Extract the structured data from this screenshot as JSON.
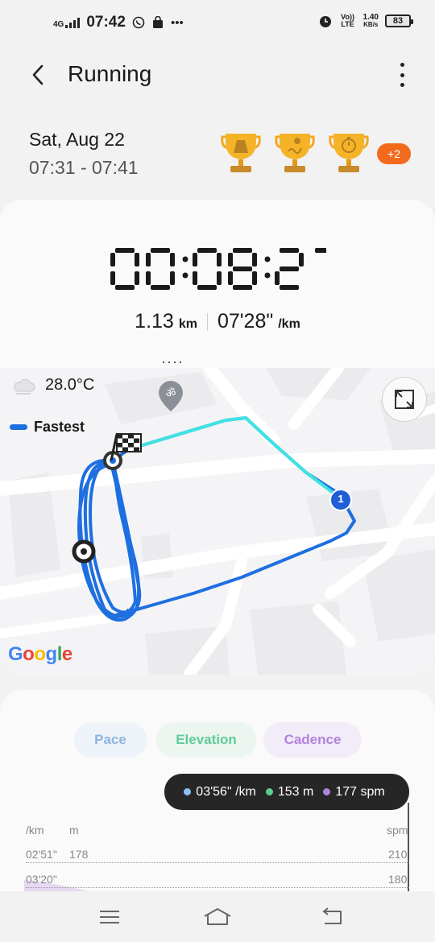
{
  "status_bar": {
    "network": "4G",
    "time": "07:42",
    "volte": "Vo)) LTE",
    "speed_value": "1.40",
    "speed_unit": "KB/s",
    "battery": "83",
    "icons": [
      "signal-icon",
      "whatsapp-icon",
      "shopping-bag-icon",
      "more-dots-icon",
      "alarm-icon",
      "battery-icon"
    ]
  },
  "header": {
    "title": "Running"
  },
  "summary": {
    "date": "Sat, Aug 22",
    "time_range": "07:31 - 07:41",
    "trophies": [
      "distance-trophy-icon",
      "route-trophy-icon",
      "stopwatch-trophy-icon"
    ],
    "more_badge": "+2"
  },
  "workout": {
    "duration": "00:08:27",
    "distance": "1.13",
    "distance_unit": "km",
    "pace": "07'28\"",
    "pace_unit": "/km"
  },
  "map": {
    "temperature": "28.0°C",
    "legend_label": "Fastest",
    "marker_label": "1",
    "attribution": "Google",
    "colors": {
      "route": "#1e6fe0",
      "fastest": "#3fe3e3"
    }
  },
  "chart": {
    "tabs": [
      {
        "label": "Pace",
        "color": "#8fb4e0"
      },
      {
        "label": "Elevation",
        "color": "#5ccd96"
      },
      {
        "label": "Cadence",
        "color": "#b281dd"
      }
    ],
    "tooltip": {
      "pace": "03'56\" /km",
      "elevation": "153 m",
      "cadence": "177 spm"
    },
    "axis_units": {
      "pace": "/km",
      "elevation": "m",
      "cadence": "spm"
    },
    "rows": [
      {
        "pace": "02'51\"",
        "elevation": "178",
        "cadence": "210"
      },
      {
        "pace": "03'20\"",
        "elevation": "",
        "cadence": "180"
      }
    ]
  },
  "nav": {
    "items": [
      "menu-icon",
      "home-icon",
      "back-icon"
    ]
  }
}
